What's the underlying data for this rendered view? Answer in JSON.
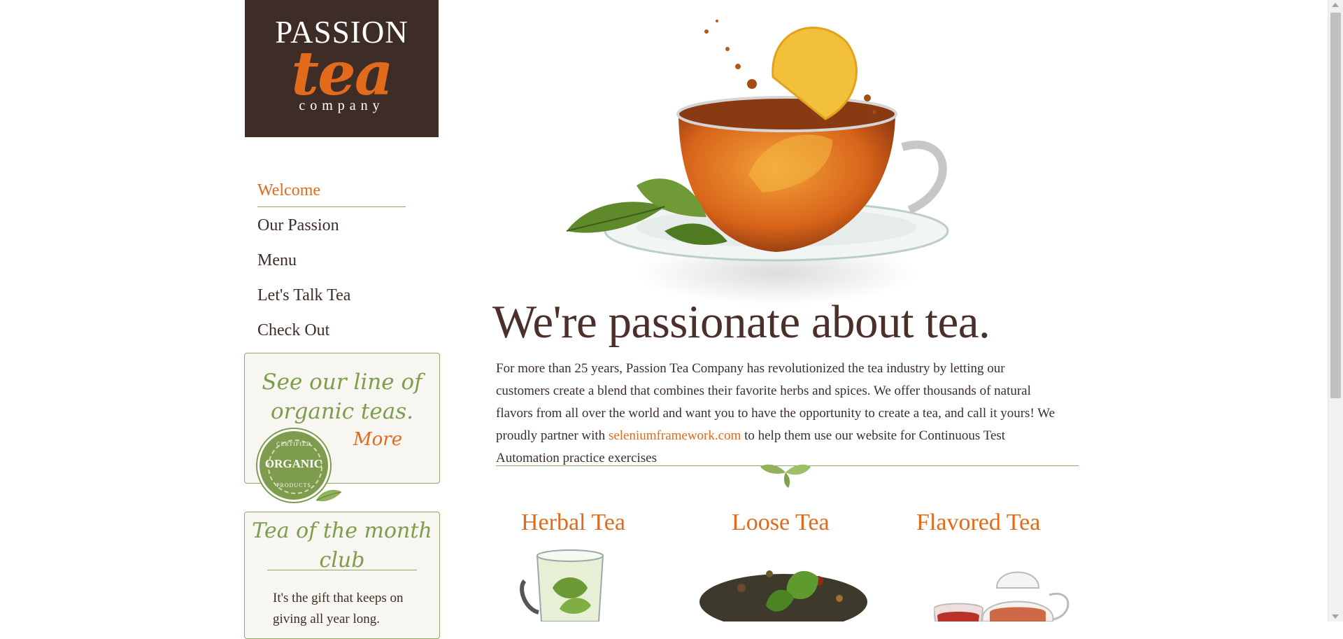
{
  "logo": {
    "line1": "PASSION",
    "line2": "tea",
    "line3": "company"
  },
  "nav": {
    "items": [
      {
        "label": "Welcome",
        "active": true
      },
      {
        "label": "Our Passion",
        "active": false
      },
      {
        "label": "Menu",
        "active": false
      },
      {
        "label": "Let's Talk Tea",
        "active": false
      },
      {
        "label": "Check Out",
        "active": false
      }
    ]
  },
  "organic_promo": {
    "headline": "See our line of organic teas.",
    "more_label": "More",
    "badge": {
      "word": "ORGANIC",
      "top": "CERTIFIED",
      "bottom": "PRODUCTS"
    }
  },
  "club_promo": {
    "headline": "Tea of the month club",
    "body": "It's the gift that keeps on giving all year long."
  },
  "main": {
    "heading": "We're passionate about tea.",
    "intro_before_link": "For more than 25 years, Passion Tea Company has revolutionized the tea industry by letting our customers create a blend that combines their favorite herbs and spices. We offer thousands of natural flavors from all over the world and want you to have the opportunity to create a tea, and call it yours! We proudly partner with ",
    "intro_link": "seleniumframework.com",
    "intro_after_link": " to help them use our website for Continuous Test Automation practice exercises"
  },
  "products": [
    {
      "label": "Herbal Tea"
    },
    {
      "label": "Loose Tea"
    },
    {
      "label": "Flavored Tea"
    }
  ],
  "colors": {
    "brand_brown": "#3e2d26",
    "accent_orange": "#e26a1b",
    "leaf_green": "#7e9c4d"
  }
}
